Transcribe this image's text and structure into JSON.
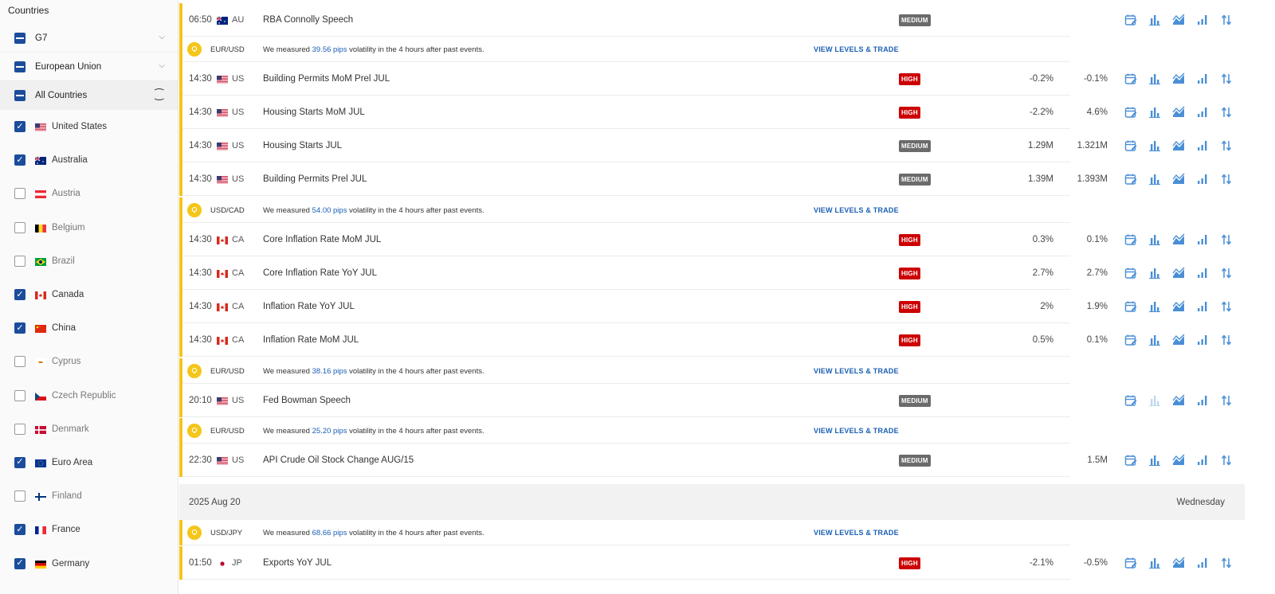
{
  "sidebar": {
    "title": "Countries",
    "groups": [
      {
        "label": "G7"
      },
      {
        "label": "European Union"
      },
      {
        "label": "All Countries"
      }
    ],
    "countries": [
      {
        "label": "United States",
        "checked": true,
        "flag": "us"
      },
      {
        "label": "Australia",
        "checked": true,
        "flag": "au"
      },
      {
        "label": "Austria",
        "checked": false,
        "flag": "at"
      },
      {
        "label": "Belgium",
        "checked": false,
        "flag": "be"
      },
      {
        "label": "Brazil",
        "checked": false,
        "flag": "br"
      },
      {
        "label": "Canada",
        "checked": true,
        "flag": "ca"
      },
      {
        "label": "China",
        "checked": true,
        "flag": "cn"
      },
      {
        "label": "Cyprus",
        "checked": false,
        "flag": "cy"
      },
      {
        "label": "Czech Republic",
        "checked": false,
        "flag": "cz"
      },
      {
        "label": "Denmark",
        "checked": false,
        "flag": "dk"
      },
      {
        "label": "Euro Area",
        "checked": true,
        "flag": "eu"
      },
      {
        "label": "Finland",
        "checked": false,
        "flag": "fi"
      },
      {
        "label": "France",
        "checked": true,
        "flag": "fr"
      },
      {
        "label": "Germany",
        "checked": true,
        "flag": "de"
      }
    ]
  },
  "volatility": {
    "prefix": "We measured ",
    "suffix": " volatility in the 4 hours after past events.",
    "link": "VIEW LEVELS & TRADE",
    "items": [
      {
        "pair": "EUR/USD",
        "pips": "39.56 pips"
      },
      {
        "pair": "USD/CAD",
        "pips": "54.00 pips"
      },
      {
        "pair": "EUR/USD",
        "pips": "38.16 pips"
      },
      {
        "pair": "EUR/USD",
        "pips": "25.20 pips"
      },
      {
        "pair": "USD/JPY",
        "pips": "68.66 pips"
      }
    ]
  },
  "events": [
    {
      "time": "06:50",
      "cc": "AU",
      "flag": "au",
      "name": "RBA Connolly Speech",
      "impact": "MEDIUM",
      "prev": "",
      "cons": ""
    },
    {
      "time": "14:30",
      "cc": "US",
      "flag": "us",
      "name": "Building Permits MoM Prel JUL",
      "impact": "HIGH",
      "prev": "-0.2%",
      "cons": "-0.1%"
    },
    {
      "time": "14:30",
      "cc": "US",
      "flag": "us",
      "name": "Housing Starts MoM JUL",
      "impact": "HIGH",
      "prev": "-2.2%",
      "cons": "4.6%"
    },
    {
      "time": "14:30",
      "cc": "US",
      "flag": "us",
      "name": "Housing Starts JUL",
      "impact": "MEDIUM",
      "prev": "1.29M",
      "cons": "1.321M"
    },
    {
      "time": "14:30",
      "cc": "US",
      "flag": "us",
      "name": "Building Permits Prel JUL",
      "impact": "MEDIUM",
      "prev": "1.39M",
      "cons": "1.393M"
    },
    {
      "time": "14:30",
      "cc": "CA",
      "flag": "ca",
      "name": "Core Inflation Rate MoM JUL",
      "impact": "HIGH",
      "prev": "0.3%",
      "cons": "0.1%"
    },
    {
      "time": "14:30",
      "cc": "CA",
      "flag": "ca",
      "name": "Core Inflation Rate YoY JUL",
      "impact": "HIGH",
      "prev": "2.7%",
      "cons": "2.7%"
    },
    {
      "time": "14:30",
      "cc": "CA",
      "flag": "ca",
      "name": "Inflation Rate YoY JUL",
      "impact": "HIGH",
      "prev": "2%",
      "cons": "1.9%"
    },
    {
      "time": "14:30",
      "cc": "CA",
      "flag": "ca",
      "name": "Inflation Rate MoM JUL",
      "impact": "HIGH",
      "prev": "0.5%",
      "cons": "0.1%"
    },
    {
      "time": "20:10",
      "cc": "US",
      "flag": "us",
      "name": "Fed Bowman Speech",
      "impact": "MEDIUM",
      "prev": "",
      "cons": ""
    },
    {
      "time": "22:30",
      "cc": "US",
      "flag": "us",
      "name": "API Crude Oil Stock Change AUG/15",
      "impact": "MEDIUM",
      "prev": "",
      "cons": "1.5M"
    },
    {
      "time": "01:50",
      "cc": "JP",
      "flag": "jp",
      "name": "Exports YoY JUL",
      "impact": "HIGH",
      "prev": "-2.1%",
      "cons": "-0.5%"
    }
  ],
  "date_header": {
    "date": "2025 Aug 20",
    "weekday": "Wednesday"
  },
  "icons": [
    "calendar-icon",
    "bar-chart-icon",
    "area-chart-icon",
    "signal-bars-icon",
    "sort-arrows-icon"
  ],
  "colors": {
    "accent": "#1a5fb4",
    "high": "#cc0000",
    "medium": "#6b6b6b",
    "highlight": "#f5c518"
  }
}
